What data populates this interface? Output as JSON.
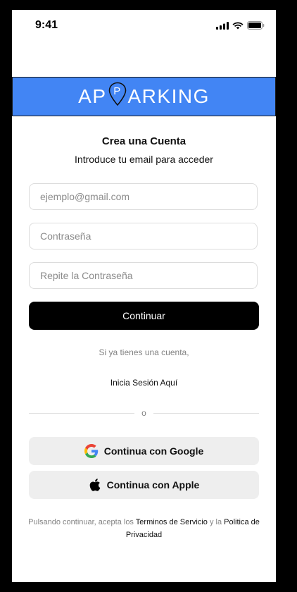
{
  "status_bar": {
    "time": "9:41",
    "icons": [
      "signal-icon",
      "wifi-icon",
      "battery-icon"
    ]
  },
  "brand": {
    "logo_left": "AP",
    "logo_pin_letter": "P",
    "logo_right": "ARKING",
    "banner_color": "#4285f4"
  },
  "signup": {
    "title": "Crea una Cuenta",
    "subtitle": "Introduce tu email para acceder",
    "email_placeholder": "ejemplo@gmail.com",
    "password_placeholder": "Contraseña",
    "repeat_password_placeholder": "Repite la Contraseña",
    "continue_label": "Continuar"
  },
  "login": {
    "prompt": "Si ya tienes una cuenta,",
    "link_label": "Inicia Sesión Aquí"
  },
  "divider": {
    "label": "o"
  },
  "social": {
    "google_label": "Continua con Google",
    "apple_label": "Continua con Apple"
  },
  "terms": {
    "prefix": "Pulsando continuar, acepta los ",
    "terms_link": "Terminos de Servicio",
    "middle": " y la ",
    "privacy_link": "Politica de Privacidad"
  }
}
